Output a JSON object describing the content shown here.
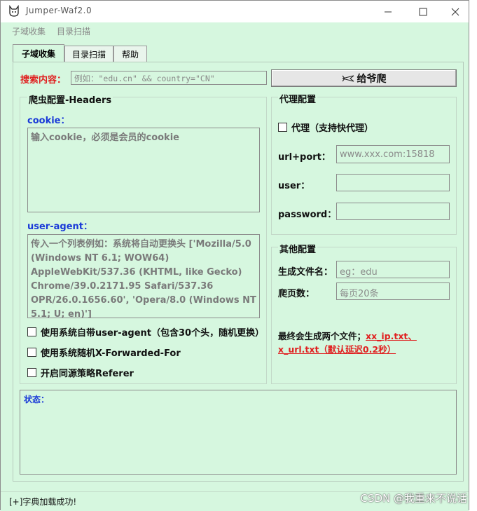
{
  "window": {
    "title": "Jumper-Waf2.0"
  },
  "menu": [
    "子域收集",
    "目录扫描"
  ],
  "tabs": [
    "子域收集",
    "目录扫描",
    "帮助"
  ],
  "search": {
    "label": "搜索内容：",
    "placeholder": "例如：\"edu.cn\" && country=\"CN\"",
    "button": "给爷爬"
  },
  "crawler": {
    "title": "爬虫配置-Headers",
    "cookie_label": "cookie：",
    "cookie_value": "输入cookie，必须是会员的cookie",
    "ua_label": "user-agent：",
    "ua_value": "传入一个列表例如：系统将自动更换头 ['Mozilla/5.0 (Windows NT 6.1; WOW64) AppleWebKit/537.36 (KHTML, like Gecko) Chrome/39.0.2171.95 Safari/537.36 OPR/26.0.1656.60', 'Opera/8.0 (Windows NT 5.1; U; en)']",
    "checks": [
      "使用系统自带user-agent（包含30个头，随机更换）",
      "使用系统随机X-Forwarded-For",
      "开启同源策略Referer"
    ]
  },
  "proxy": {
    "title": "代理配置",
    "check": "代理（支持快代理）",
    "url_label": "url+port：",
    "url_value": "www.xxx.com:15818",
    "user_label": "user：",
    "user_value": "",
    "password_label": "password：",
    "password_value": ""
  },
  "other": {
    "title": "其他配置",
    "filename_label": "生成文件名：",
    "filename_value": "eg：edu",
    "pages_label": "爬页数：",
    "pages_value": "每页20条",
    "note_black": "最终会生成两个文件；",
    "note_red1": "xx_ip.txt、",
    "note_red2": "x_url.txt（默认延迟0.2秒）"
  },
  "status": {
    "label": "状态："
  },
  "statusbar": {
    "text": "[+]字典加载成功!"
  },
  "watermark": "CSDN @我重来不说话"
}
